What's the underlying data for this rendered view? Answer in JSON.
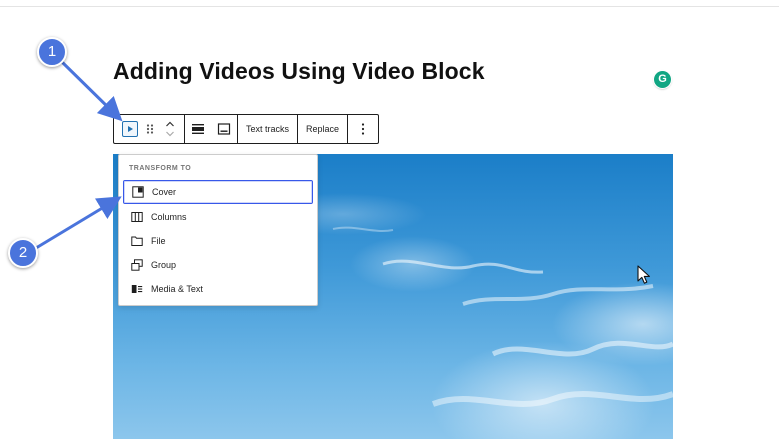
{
  "editor": {
    "post_title": "Adding Videos Using Video Block"
  },
  "grammarly": {
    "letter": "G",
    "color": "#11a683"
  },
  "toolbar": {
    "block_icon": "video-icon",
    "drag_icon": "drag-handle-icon",
    "move_up_icon": "chevron-up-icon",
    "move_down_icon": "chevron-down-icon",
    "align_icon": "align-wide-icon",
    "caption_icon": "caption-icon",
    "text_tracks_label": "Text tracks",
    "replace_label": "Replace",
    "more_icon": "more-vertical-icon"
  },
  "transform_menu": {
    "heading": "TRANSFORM TO",
    "items": [
      {
        "label": "Cover",
        "icon": "cover-icon",
        "selected": true
      },
      {
        "label": "Columns",
        "icon": "columns-icon",
        "selected": false
      },
      {
        "label": "File",
        "icon": "file-icon",
        "selected": false
      },
      {
        "label": "Group",
        "icon": "group-icon",
        "selected": false
      },
      {
        "label": "Media & Text",
        "icon": "media-text-icon",
        "selected": false
      }
    ]
  },
  "annotations": {
    "badge_1": "1",
    "badge_2": "2",
    "color": "#4a74dc"
  },
  "colors": {
    "accent": "#3858e9",
    "toolbar_border": "#1e1e1e",
    "sky_top": "#1b7ec8",
    "sky_bottom": "#8cc6ec"
  }
}
